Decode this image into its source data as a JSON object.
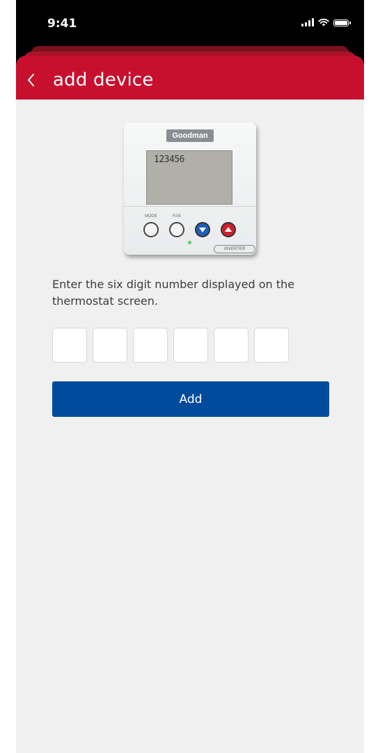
{
  "status_bar": {
    "time": "9:41",
    "icons": [
      "cellular-signal-icon",
      "wifi-icon",
      "battery-icon"
    ]
  },
  "header": {
    "back_icon": "chevron-left-icon",
    "title": "add device",
    "color": "#c8102e"
  },
  "thermostat": {
    "brand": "Goodman",
    "display_digits": "123456",
    "mode_label": "MODE",
    "fan_label": "FAN",
    "badge": "INVERTER",
    "buttons": [
      "mode-button",
      "fan-button",
      "down-arrow-button",
      "up-arrow-button"
    ]
  },
  "instructions": "Enter the six digit number displayed on the thermostat screen.",
  "code_input": {
    "digit_count": 6,
    "values": [
      "",
      "",
      "",
      "",
      "",
      ""
    ]
  },
  "add_button": {
    "label": "Add",
    "color": "#004b9c"
  }
}
